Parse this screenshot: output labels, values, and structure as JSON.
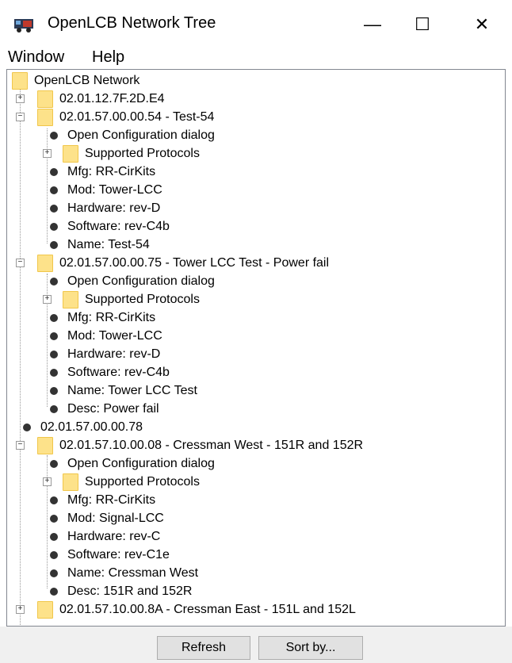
{
  "window": {
    "title": "OpenLCB Network Tree",
    "minimize_glyph": "—",
    "maximize_glyph": "☐",
    "close_glyph": "✕"
  },
  "menu": [
    "Window",
    "Help"
  ],
  "tree": {
    "root": "OpenLCB Network",
    "nodes": [
      "02.01.12.7F.2D.E4",
      "02.01.57.00.00.54 - Test-54",
      "Open Configuration dialog",
      "Supported Protocols",
      "Mfg: RR-CirKits",
      "Mod: Tower-LCC",
      "Hardware: rev-D",
      "Software: rev-C4b",
      "Name: Test-54",
      "02.01.57.00.00.75 - Tower LCC Test - Power fail",
      "Open Configuration dialog",
      "Supported Protocols",
      "Mfg: RR-CirKits",
      "Mod: Tower-LCC",
      "Hardware: rev-D",
      "Software: rev-C4b",
      "Name: Tower LCC Test",
      "Desc: Power fail",
      "02.01.57.00.00.78",
      "02.01.57.10.00.08 - Cressman West - 151R and 152R",
      "Open Configuration dialog",
      "Supported Protocols",
      "Mfg: RR-CirKits",
      "Mod: Signal-LCC",
      "Hardware: rev-C",
      "Software: rev-C1e",
      "Name: Cressman West",
      "Desc: 151R and 152R",
      "02.01.57.10.00.8A - Cressman East - 151L and 152L"
    ]
  },
  "buttons": {
    "refresh": "Refresh",
    "sort": "Sort by..."
  },
  "icons": {
    "app": "train-icon",
    "folder": "folder-icon",
    "leaf": "leaf-dot-icon",
    "expander": "expand-collapse-icon"
  },
  "colors": {
    "folder": "#fde28a",
    "folder_border": "#f0c64a",
    "border": "#828790",
    "button_bg": "#e1e1e1"
  }
}
